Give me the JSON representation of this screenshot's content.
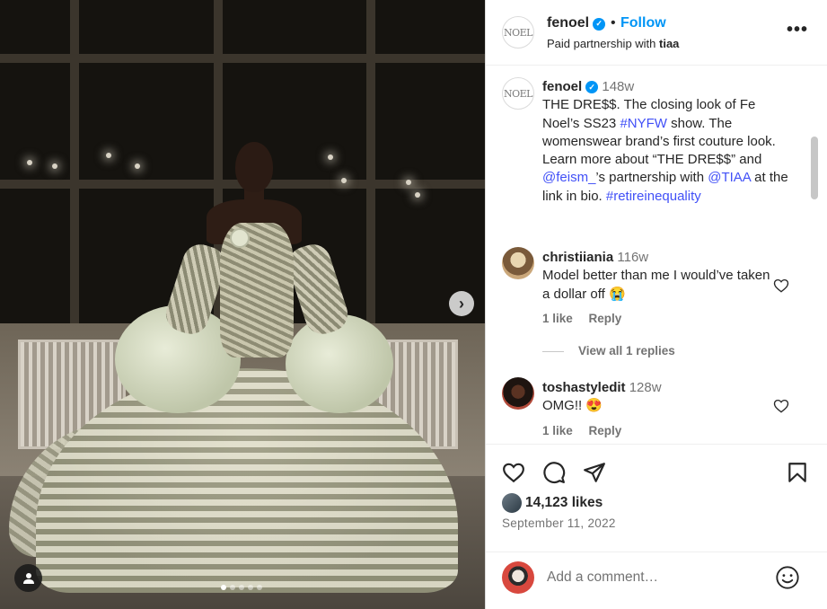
{
  "post": {
    "media": {
      "slide_count": 5,
      "active_slide": 1,
      "next_icon": "chevron-right-icon",
      "tag_icon": "user-tag-icon"
    },
    "header": {
      "username": "fenoel",
      "verified": true,
      "separator": "•",
      "follow_label": "Follow",
      "subtitle_prefix": "Paid partnership with ",
      "subtitle_partner": "tiaa",
      "avatar_text": "NOEL",
      "more_icon": "more-horizontal-icon",
      "more_label": "•••"
    },
    "caption": {
      "username": "fenoel",
      "time": "148w",
      "text_1": "THE DRE$$. The closing look of Fe Noel’s SS23 ",
      "hashtag_1": "#NYFW",
      "text_2": " show. The womenswear brand’s first couture look. Learn more about “THE DRE$$” and ",
      "mention_1": "@feism_",
      "text_3": "’s partnership with ",
      "mention_2": "@TIAA",
      "text_4": " at the link in bio. ",
      "hashtag_2": "#retireinequality"
    },
    "comments": [
      {
        "username": "christiiania",
        "time": "116w",
        "text": "Model better than me I would’ve taken a dollar off 😭",
        "likes": "1 like",
        "reply_label": "Reply",
        "view_replies": "View all 1 replies"
      },
      {
        "username": "toshastyledit",
        "time": "128w",
        "text": "OMG!! 😍",
        "likes": "1 like",
        "reply_label": "Reply"
      }
    ],
    "actions": {
      "like_icon": "heart-icon",
      "comment_icon": "comment-icon",
      "share_icon": "send-icon",
      "save_icon": "bookmark-icon"
    },
    "likes": "14,123 likes",
    "date": "September 11, 2022",
    "add_comment": {
      "placeholder": "Add a comment…",
      "emoji_icon": "emoji-icon"
    }
  },
  "colors": {
    "link": "#4150f7",
    "follow": "#0095f6",
    "secondary_text": "#737373"
  }
}
